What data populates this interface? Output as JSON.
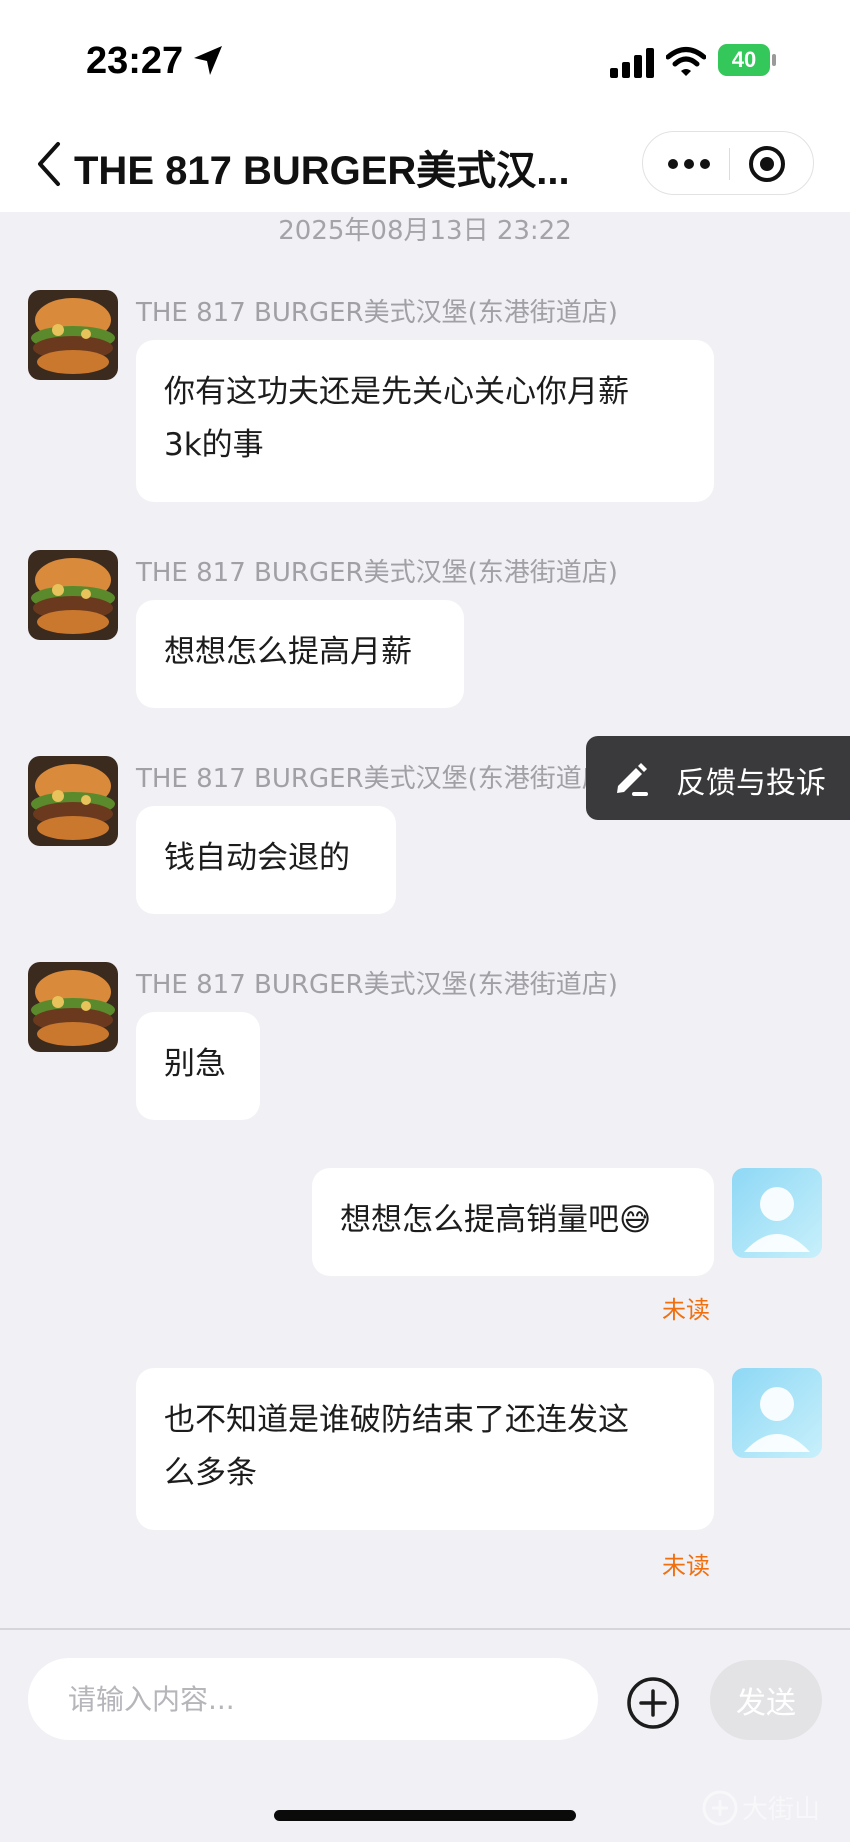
{
  "status_bar": {
    "time": "23:27",
    "battery": "40",
    "icons": [
      "location-arrow-icon",
      "signal-icon",
      "wifi-icon",
      "battery-charging-icon"
    ]
  },
  "nav": {
    "title": "THE 817 BURGER美式汉...",
    "back_icon": "chevron-left-icon",
    "more_icon": "more-dots-icon",
    "close_icon": "target-circle-icon"
  },
  "chat": {
    "timestamp": "2025年08月13日 23:22",
    "messages": [
      {
        "from": "shop",
        "sender": "THE 817 BURGER美式汉堡(东港街道店)",
        "line1": "你有这功夫还是先关心关心你月薪",
        "line2": "3k的事"
      },
      {
        "from": "shop",
        "sender": "THE 817 BURGER美式汉堡(东港街道店)",
        "text": "想想怎么提高月薪"
      },
      {
        "from": "shop",
        "sender": "THE 817 BURGER美式汉堡(东港街道店)",
        "text": "钱自动会退的"
      },
      {
        "from": "shop",
        "sender": "THE 817 BURGER美式汉堡(东港街道店)",
        "text": "别急"
      },
      {
        "from": "me",
        "text": "想想怎么提高销量吧",
        "emoji": "😅",
        "status": "未读"
      },
      {
        "from": "me",
        "line1": "也不知道是谁破防结束了还连发这",
        "line2": "么多条",
        "status": "未读"
      }
    ]
  },
  "feedback": {
    "label": "反馈与投诉",
    "icon": "edit-pen-icon"
  },
  "input": {
    "placeholder": "请输入内容...",
    "value": "",
    "send_label": "发送",
    "plus_icon": "plus-circle-icon"
  },
  "watermark": {
    "text": "大街山"
  },
  "colors": {
    "background": "#f0f0f5",
    "bubble": "#ffffff",
    "unread": "#f07010",
    "feedback_bg": "#3a3a3c",
    "send_disabled": "#e3e3e6"
  }
}
